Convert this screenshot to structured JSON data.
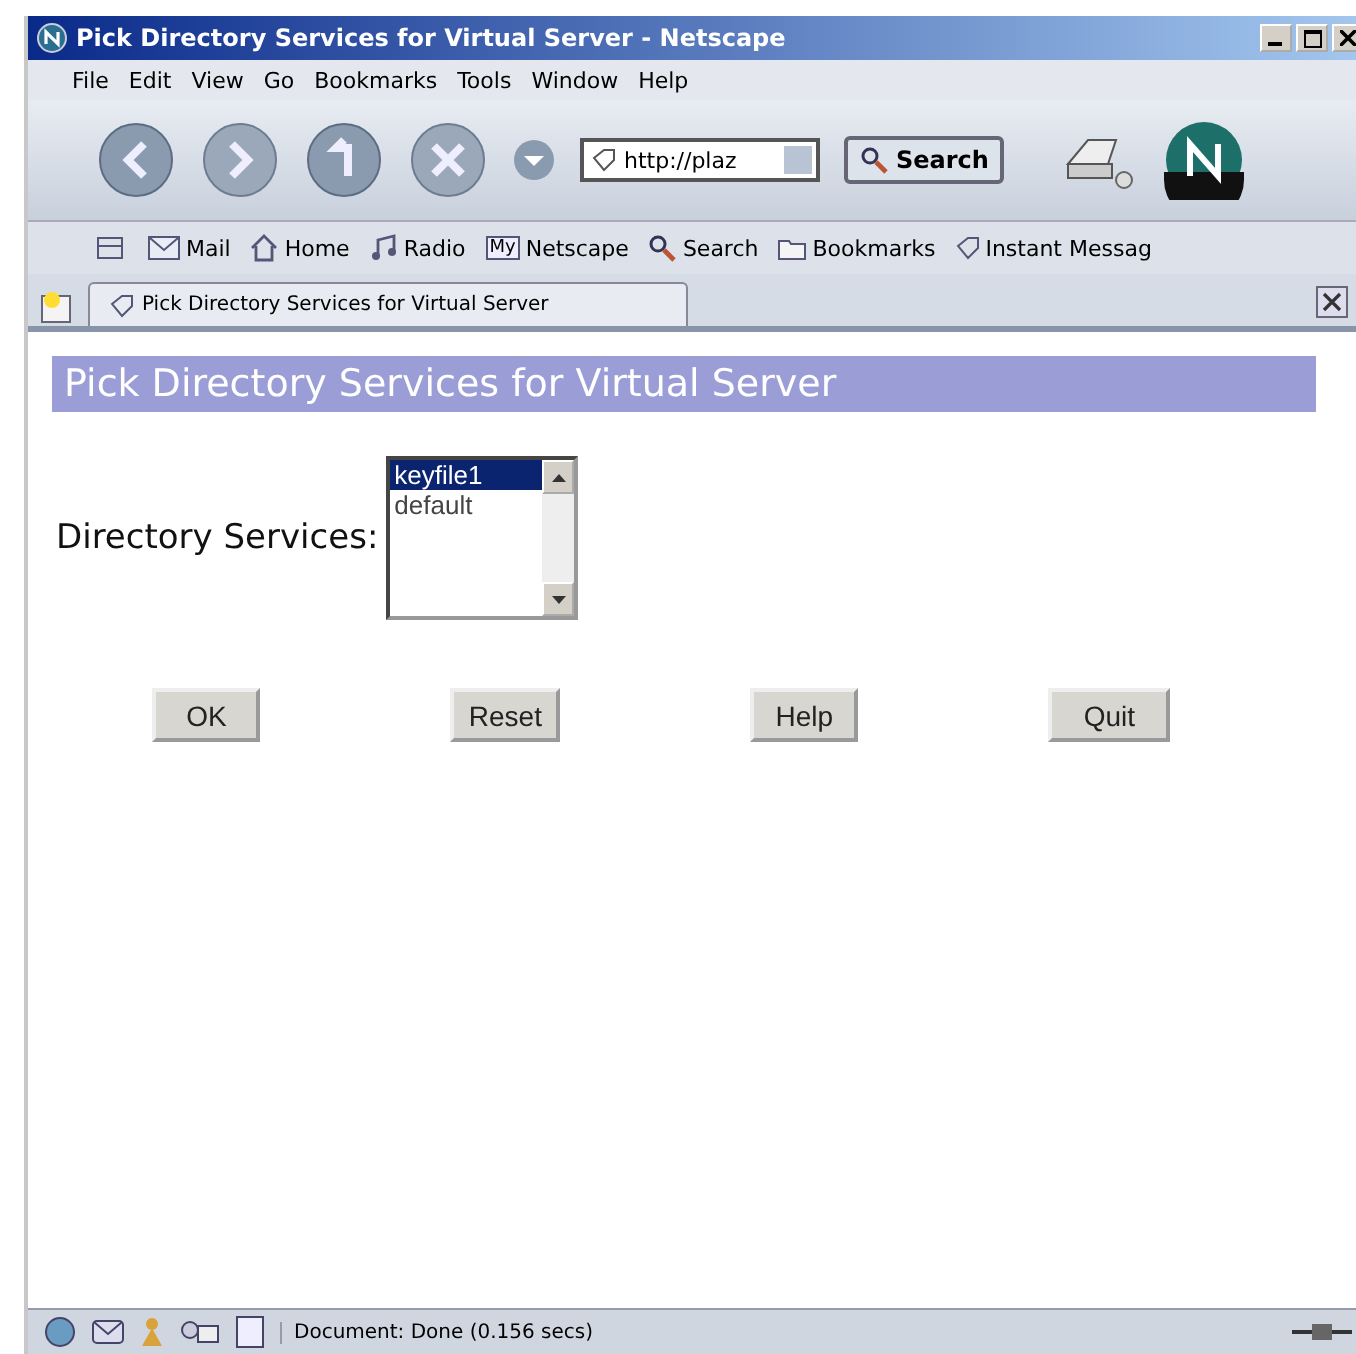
{
  "window": {
    "title": "Pick Directory Services for Virtual Server - Netscape"
  },
  "menu": [
    "File",
    "Edit",
    "View",
    "Go",
    "Bookmarks",
    "Tools",
    "Window",
    "Help"
  ],
  "navigation": {
    "url": "http://plaz",
    "search_button": "Search"
  },
  "personal_toolbar": [
    {
      "kind": "mail",
      "label": "Mail"
    },
    {
      "kind": "home",
      "label": "Home"
    },
    {
      "kind": "radio",
      "label": "Radio"
    },
    {
      "kind": "netscape",
      "label": "Netscape",
      "icon_text": "My"
    },
    {
      "kind": "search",
      "label": "Search"
    },
    {
      "kind": "bookmarks",
      "label": "Bookmarks"
    },
    {
      "kind": "im",
      "label": "Instant Messag"
    }
  ],
  "tab": {
    "label": "Pick Directory Services for Virtual Server"
  },
  "page": {
    "heading": "Pick Directory Services for Virtual Server",
    "field_label": "Directory Services:",
    "options": [
      {
        "label": "keyfile1",
        "selected": true
      },
      {
        "label": "default",
        "selected": false
      }
    ],
    "buttons": [
      "OK",
      "Reset",
      "Help",
      "Quit"
    ]
  },
  "status_bar": {
    "text": "Document: Done (0.156 secs)"
  }
}
